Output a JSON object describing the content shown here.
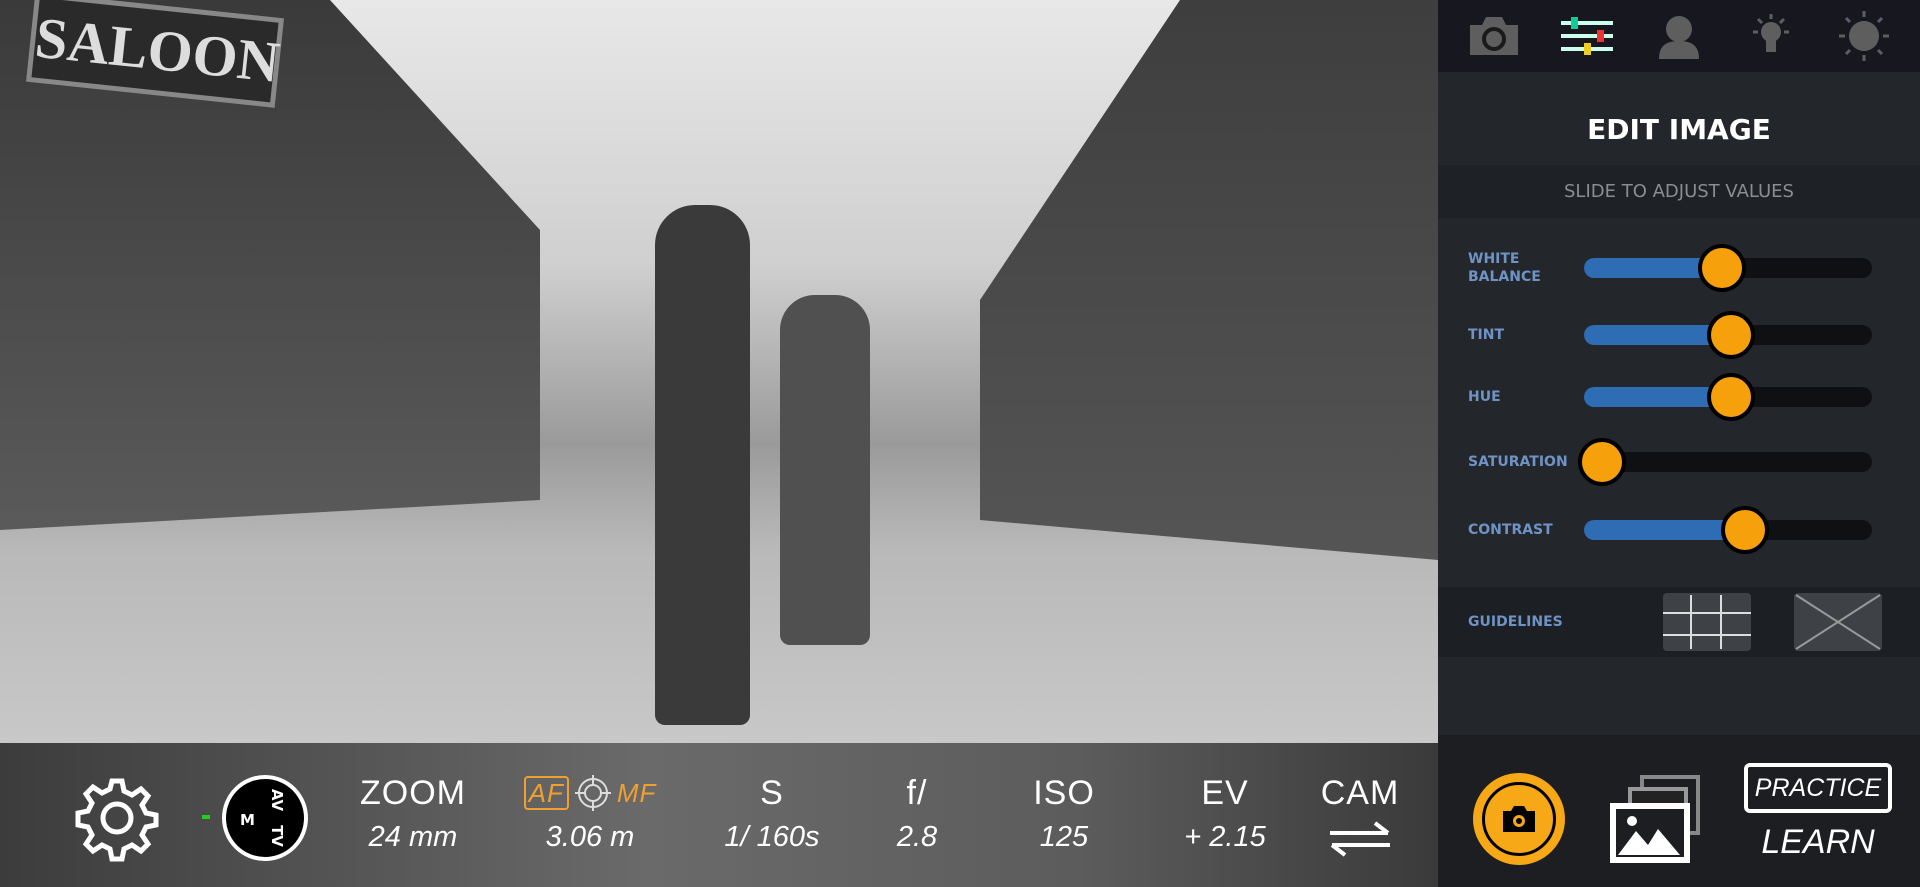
{
  "scene": {
    "sign": "SALOON"
  },
  "bottom_bar": {
    "mode_dial": {
      "labels": [
        "AV",
        "TV",
        "M"
      ]
    },
    "zoom": {
      "label": "ZOOM",
      "value": "24 mm"
    },
    "focus": {
      "af": "AF",
      "mf": "MF",
      "value": "3.06 m"
    },
    "shutter": {
      "label": "S",
      "value": "1/ 160s"
    },
    "aperture": {
      "label": "f/",
      "value": "2.8"
    },
    "iso": {
      "label": "ISO",
      "value": "125"
    },
    "ev": {
      "label": "EV",
      "value": "+ 2.15"
    },
    "cam": {
      "label": "CAM"
    }
  },
  "panel": {
    "tabs": [
      "camera",
      "adjust",
      "portrait",
      "lighting",
      "sun"
    ],
    "active_tab": "adjust",
    "title": "EDIT IMAGE",
    "subtitle": "SLIDE TO ADJUST VALUES",
    "sliders": [
      {
        "label": "WHITE BALANCE",
        "value": 0.48
      },
      {
        "label": "TINT",
        "value": 0.51
      },
      {
        "label": "HUE",
        "value": 0.51
      },
      {
        "label": "SATURATION",
        "value": 0.0
      },
      {
        "label": "CONTRAST",
        "value": 0.56
      }
    ],
    "guidelines_label": "GUIDELINES",
    "practice": "PRACTICE",
    "learn": "LEARN"
  },
  "colors": {
    "accent": "#f6a10c",
    "slider_fill": "#2e6cb4",
    "label": "#6f93c4"
  }
}
